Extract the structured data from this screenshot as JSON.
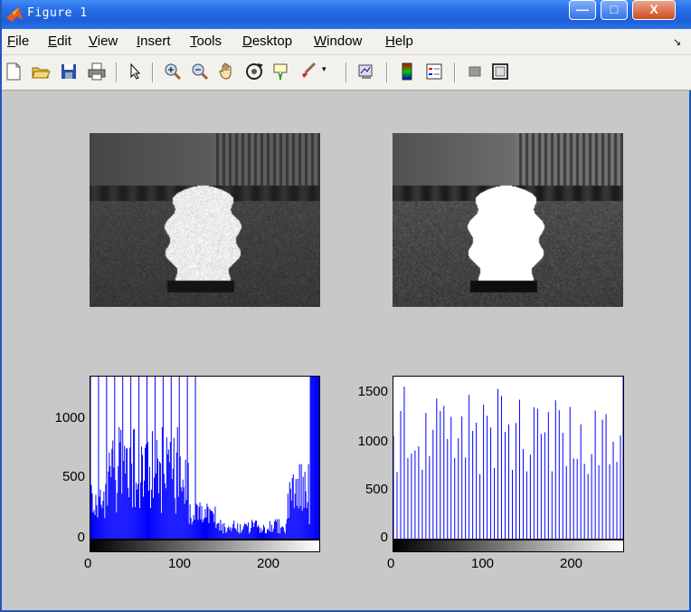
{
  "window": {
    "title": "Figure 1",
    "minimize": "—",
    "maximize": "□",
    "close": "X"
  },
  "menu": [
    {
      "accel": "F",
      "rest": "ile"
    },
    {
      "accel": "E",
      "rest": "dit"
    },
    {
      "accel": "V",
      "rest": "iew"
    },
    {
      "accel": "I",
      "rest": "nsert"
    },
    {
      "accel": "T",
      "rest": "ools"
    },
    {
      "accel": "D",
      "rest": "esktop"
    },
    {
      "accel": "W",
      "rest": "indow"
    },
    {
      "accel": "H",
      "rest": "elp"
    }
  ],
  "toolbar": [
    "new-figure-icon",
    "open-file-icon",
    "save-icon",
    "print-icon",
    "pointer-icon",
    "zoom-in-icon",
    "zoom-out-icon",
    "pan-hand-icon",
    "rotate-3d-icon",
    "data-cursor-icon",
    "brush-icon",
    "link-plot-icon",
    "colorbar-icon",
    "legend-icon",
    "hide-plot-tools-icon",
    "show-plot-tools-icon"
  ],
  "chart_data": [
    {
      "type": "bar",
      "x_ticks": [
        "0",
        "100",
        "200"
      ],
      "y_ticks": [
        "0",
        "500",
        "1000"
      ],
      "xlim": [
        0,
        255
      ],
      "ylim": [
        0,
        1300
      ],
      "color": "#0000ff"
    },
    {
      "type": "bar",
      "x_ticks": [
        "0",
        "100",
        "200"
      ],
      "y_ticks": [
        "0",
        "500",
        "1000",
        "1500"
      ],
      "xlim": [
        0,
        255
      ],
      "ylim": [
        0,
        1650
      ],
      "color": "#0000ff"
    }
  ]
}
